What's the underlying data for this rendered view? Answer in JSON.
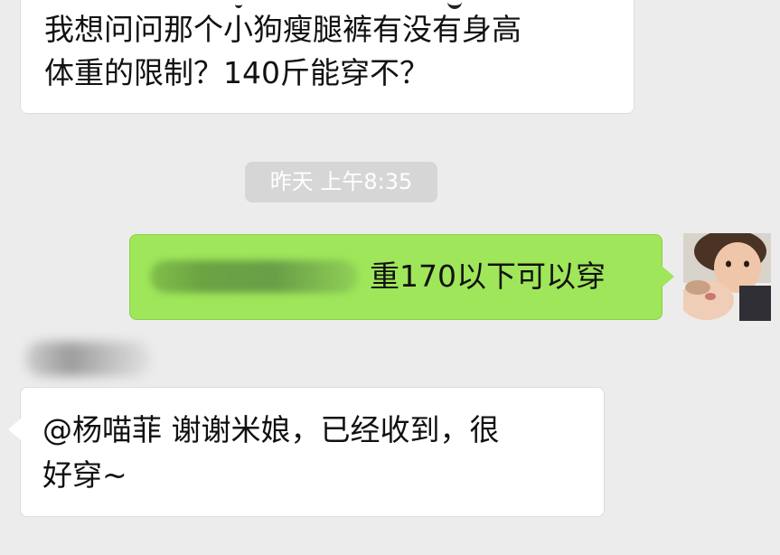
{
  "messages": {
    "top_received": {
      "text": "我想问问那个小狗瘦腿裤有没有身高\n体重的限制？140斤能穿不？"
    },
    "timestamp": "昨天 上午8:35",
    "sent": {
      "text": "重170以下可以穿"
    },
    "bottom_received": {
      "text": "@杨喵菲 谢谢米娘，已经收到，很\n好穿~"
    }
  },
  "colors": {
    "background": "#ececec",
    "sent_bubble": "#9fe65a",
    "received_bubble": "#ffffff",
    "timestamp_bg": "#d6d6d6"
  }
}
